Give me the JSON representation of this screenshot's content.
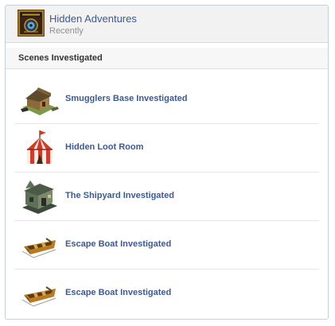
{
  "app": {
    "name": "Hidden Adventures",
    "subtitle": "Recently",
    "icon": "hidden-adventures-app-icon"
  },
  "section": {
    "title": "Scenes Investigated"
  },
  "items": [
    {
      "label": "Smugglers Base Investigated",
      "icon": "smugglers-base-icon"
    },
    {
      "label": "Hidden Loot Room",
      "icon": "circus-tent-icon"
    },
    {
      "label": "The Shipyard Investigated",
      "icon": "shipyard-building-icon"
    },
    {
      "label": "Escape Boat Investigated",
      "icon": "escape-boat-icon"
    },
    {
      "label": "Escape Boat Investigated",
      "icon": "escape-boat-icon"
    }
  ],
  "colors": {
    "link": "#3b5998",
    "header_bg": "#f2f2f2",
    "border": "#c9cfd8"
  }
}
